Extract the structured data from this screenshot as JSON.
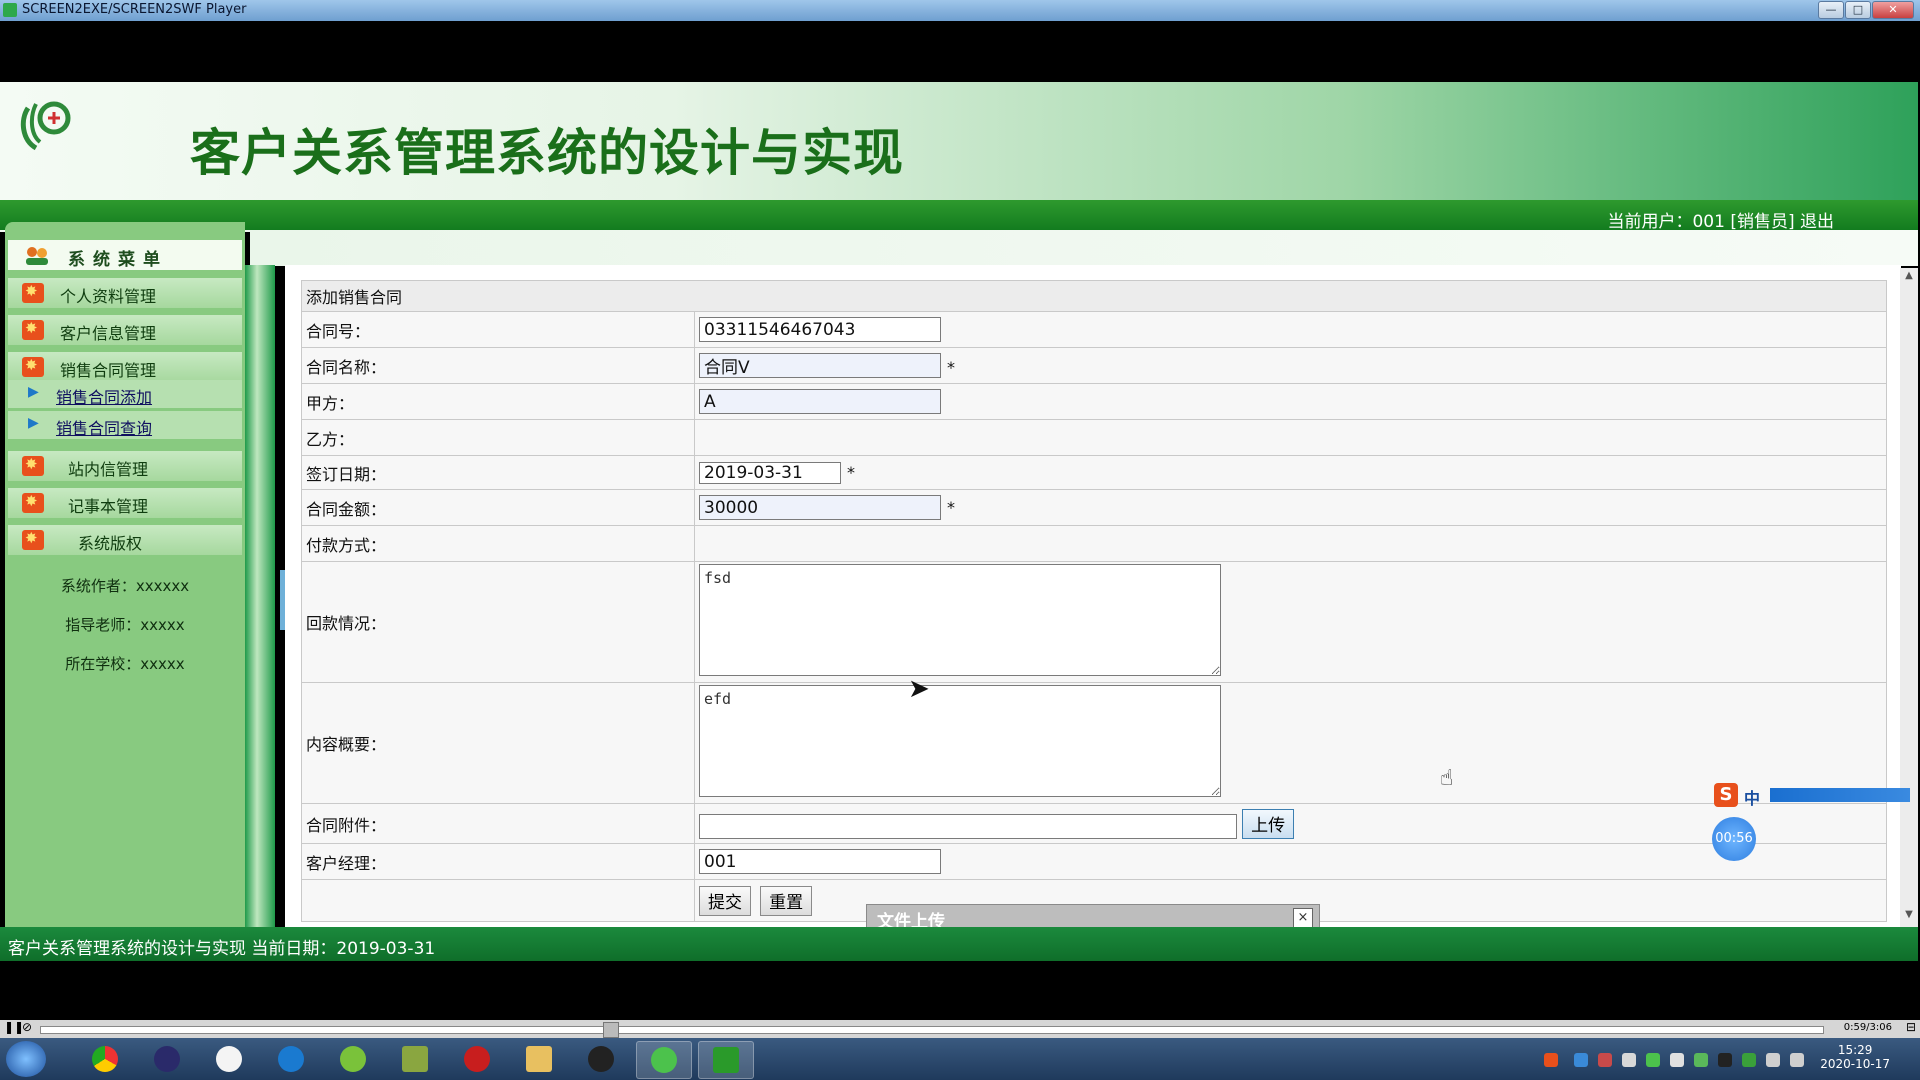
{
  "window": {
    "title": "SCREEN2EXE/SCREEN2SWF Player",
    "min": "—",
    "max": "□",
    "close": "✕"
  },
  "header": {
    "system_title": "客户关系管理系统的设计与实现",
    "user_prefix": "当前用户：001 [销售员]",
    "logout": "退出"
  },
  "sidebar": {
    "title": "系统菜单",
    "menus": [
      {
        "label": "个人资料管理"
      },
      {
        "label": "客户信息管理"
      },
      {
        "label": "销售合同管理"
      },
      {
        "label": "站内信管理"
      },
      {
        "label": "记事本管理"
      },
      {
        "label": "系统版权"
      }
    ],
    "submenus": [
      {
        "label": "销售合同添加"
      },
      {
        "label": "销售合同查询"
      }
    ],
    "info": [
      {
        "text": "系统作者：xxxxxx"
      },
      {
        "text": "指导老师：xxxxx"
      },
      {
        "text": "所在学校：xxxxx"
      }
    ]
  },
  "form": {
    "heading": "添加销售合同",
    "fields": {
      "contract_no": {
        "label": "合同号：",
        "value": "03311546467043"
      },
      "contract_name": {
        "label": "合同名称：",
        "value": "合同V",
        "required": "*"
      },
      "party_a": {
        "label": "甲方：",
        "value": "A"
      },
      "party_b": {
        "label": "乙方："
      },
      "sign_date": {
        "label": "签订日期：",
        "value": "2019-03-31",
        "required": "*"
      },
      "amount": {
        "label": "合同金额：",
        "value": "30000",
        "required": "*"
      },
      "payment": {
        "label": "付款方式："
      },
      "refund": {
        "label": "回款情况：",
        "value": "fsd"
      },
      "summary": {
        "label": "内容概要：",
        "value": "efd"
      },
      "attachment": {
        "label": "合同附件：",
        "value": "",
        "upload_label": "上传"
      },
      "manager": {
        "label": "客户经理：",
        "value": "001"
      }
    },
    "submit_label": "提交",
    "reset_label": "重置"
  },
  "popup": {
    "title": "文件上传",
    "close": "×"
  },
  "statusbar": {
    "text": "客户关系管理系统的设计与实现 当前日期：2019-03-31"
  },
  "player": {
    "time": "0:59/3:06"
  },
  "overlay": {
    "ime_logo": "S",
    "ime_mode": "中",
    "record_time": "00:56"
  },
  "taskbar": {
    "clock_time": "15:29",
    "clock_date": "2020-10-17"
  },
  "colors": {
    "header_green": "#137c1f",
    "sidebar_green": "#88ca80",
    "status_green": "#0f6e2a",
    "title_text": "#1a6f1a"
  }
}
